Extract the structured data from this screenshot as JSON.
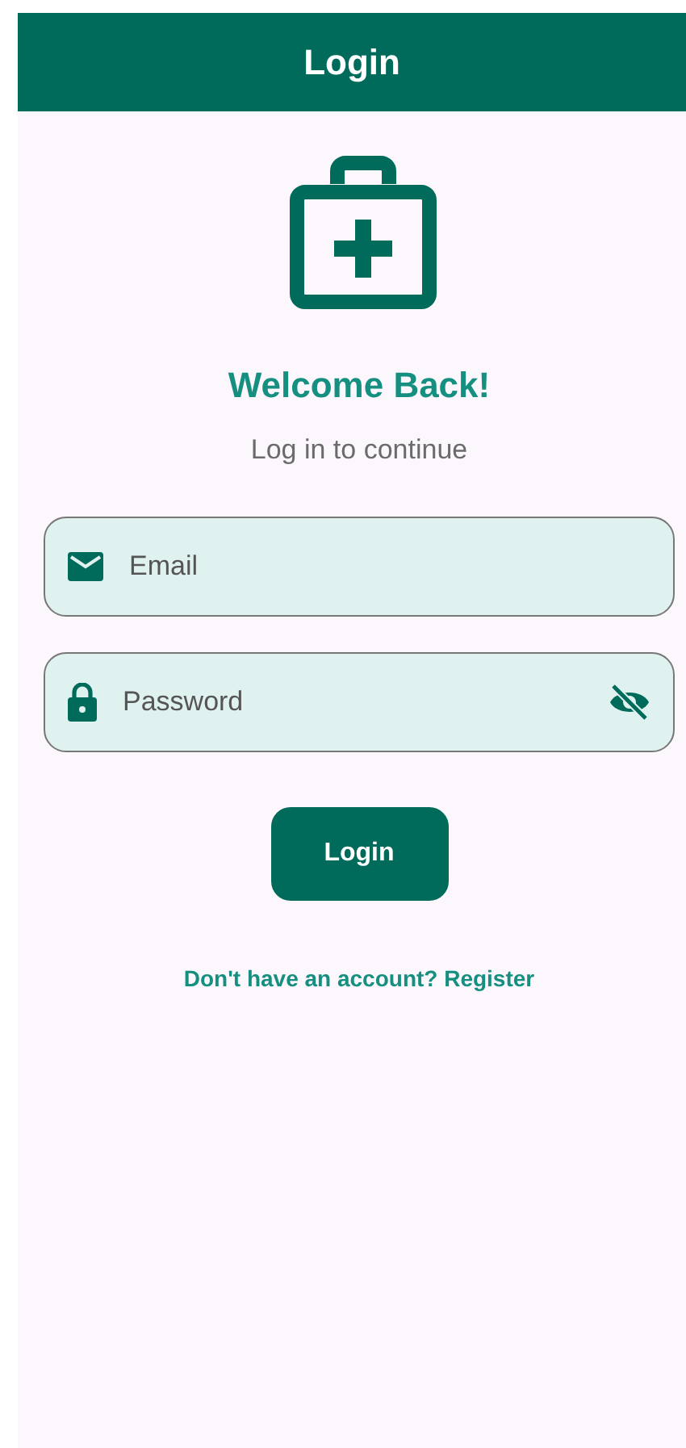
{
  "app_bar": {
    "title": "Login"
  },
  "heading": "Welcome Back!",
  "subheading": "Log in to continue",
  "fields": [
    {
      "kind": "email",
      "placeholder": "Email"
    },
    {
      "kind": "password",
      "placeholder": "Password",
      "obscured": true
    }
  ],
  "login_button": "Login",
  "register_link": "Don't have an account? Register"
}
